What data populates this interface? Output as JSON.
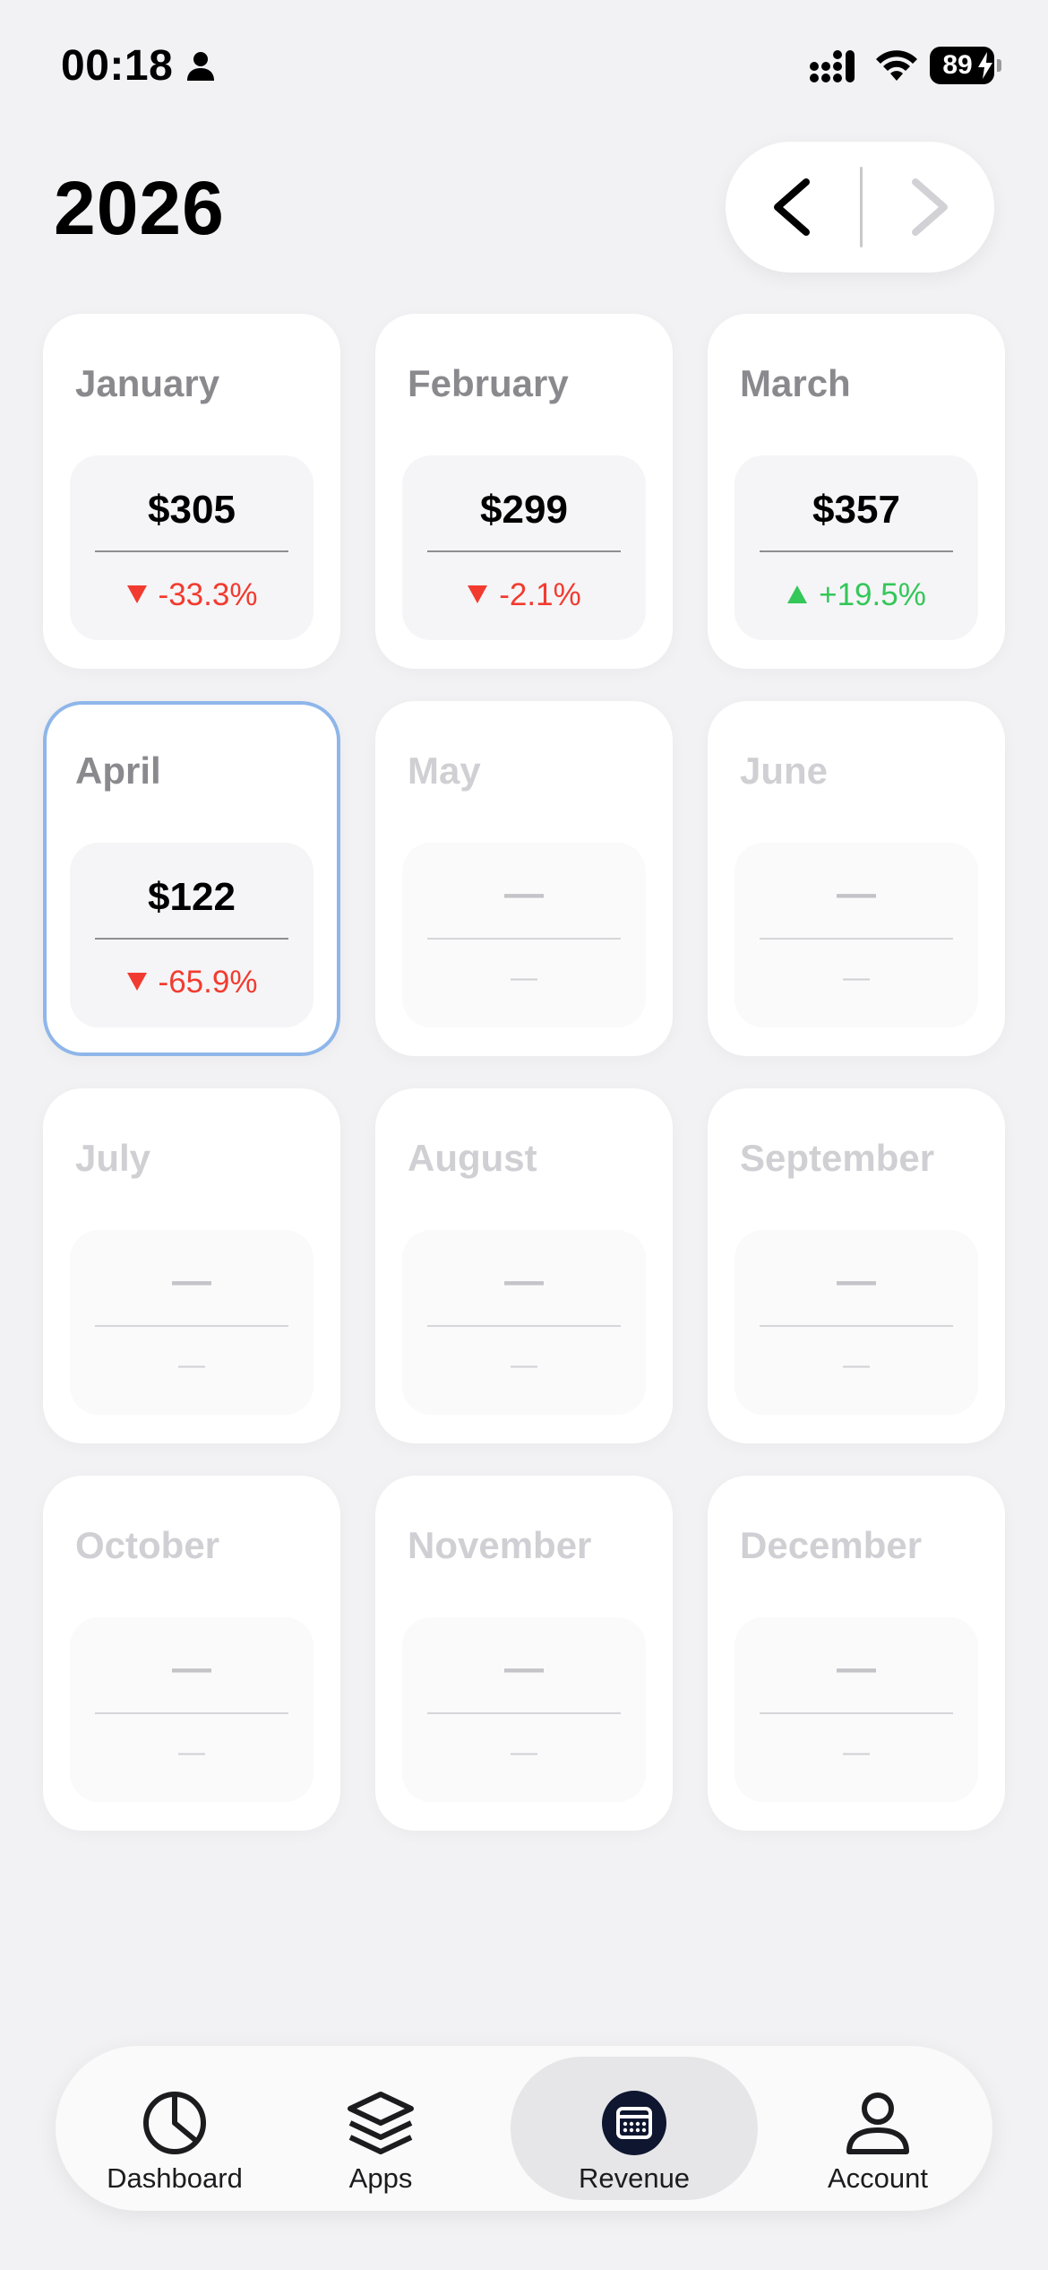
{
  "status_bar": {
    "time": "00:18",
    "battery": "89",
    "battery_level_percent": 89
  },
  "header": {
    "year": "2026"
  },
  "months": [
    {
      "name": "January",
      "value": "$305",
      "change": "-33.3%",
      "trend": "down",
      "state": "past"
    },
    {
      "name": "February",
      "value": "$299",
      "change": "-2.1%",
      "trend": "down",
      "state": "past"
    },
    {
      "name": "March",
      "value": "$357",
      "change": "+19.5%",
      "trend": "up",
      "state": "past"
    },
    {
      "name": "April",
      "value": "$122",
      "change": "-65.9%",
      "trend": "down",
      "state": "selected"
    },
    {
      "name": "May",
      "value": "—",
      "change": "—",
      "trend": "none",
      "state": "future"
    },
    {
      "name": "June",
      "value": "—",
      "change": "—",
      "trend": "none",
      "state": "future"
    },
    {
      "name": "July",
      "value": "—",
      "change": "—",
      "trend": "none",
      "state": "future"
    },
    {
      "name": "August",
      "value": "—",
      "change": "—",
      "trend": "none",
      "state": "future"
    },
    {
      "name": "September",
      "value": "—",
      "change": "—",
      "trend": "none",
      "state": "future"
    },
    {
      "name": "October",
      "value": "—",
      "change": "—",
      "trend": "none",
      "state": "future"
    },
    {
      "name": "November",
      "value": "—",
      "change": "—",
      "trend": "none",
      "state": "future"
    },
    {
      "name": "December",
      "value": "—",
      "change": "—",
      "trend": "none",
      "state": "future"
    }
  ],
  "tabs": [
    {
      "label": "Dashboard",
      "icon": "pie-chart-icon",
      "active": false
    },
    {
      "label": "Apps",
      "icon": "stack-icon",
      "active": false
    },
    {
      "label": "Revenue",
      "icon": "calendar-icon",
      "active": true
    },
    {
      "label": "Account",
      "icon": "person-icon",
      "active": false
    }
  ],
  "colors": {
    "accent_selected_border": "#8FB6EA",
    "negative": "#F23B30",
    "positive": "#34C759",
    "background": "#F2F2F4"
  }
}
